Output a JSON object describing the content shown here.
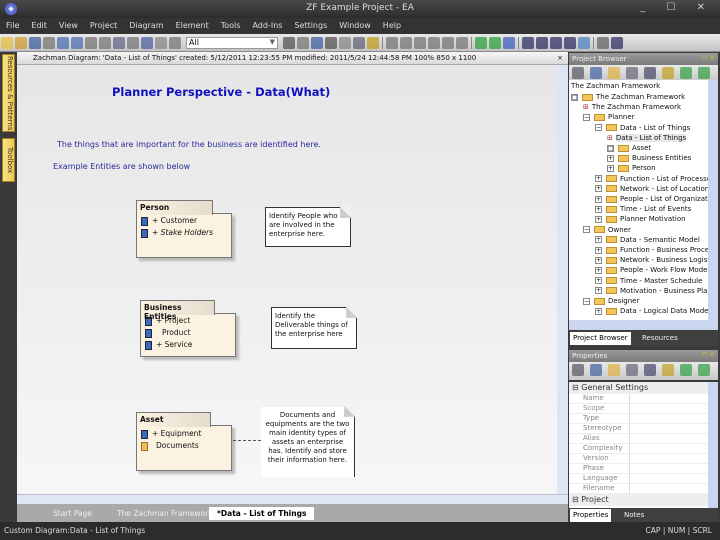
{
  "window": {
    "title": "ZF Example Project - EA",
    "logo": "ea-logo-icon",
    "controls": "_ ☐ ✕"
  },
  "menu": [
    "File",
    "Edit",
    "View",
    "Project",
    "Diagram",
    "Element",
    "Tools",
    "Add-Ins",
    "Settings",
    "Window",
    "Help"
  ],
  "toolbar": {
    "combo_value": "All"
  },
  "left_tabs": [
    "Resources & Patterns",
    "Toolbox"
  ],
  "diagram": {
    "header": "Zachman Diagram: 'Data - List of Things' created: 5/12/2011 12:23:55 PM modified: 2011/5/24 12:44:58 PM 100% 850 x 1100",
    "title": "Planner Perspective - Data(What)",
    "intro": "The things that are important for the business are identified here.",
    "example": "Example Entities are shown below",
    "classes": [
      {
        "name": "Person",
        "attrs": [
          "+ Customer",
          "+ Stake Holders"
        ]
      },
      {
        "name": "Business Entities",
        "attrs": [
          "+ Project",
          "Product",
          "+ Service"
        ]
      },
      {
        "name": "Asset",
        "attrs": [
          "+ Equipment",
          "Documents"
        ]
      }
    ],
    "notes": [
      "Identify People who are involved in the enterprise here.",
      "Identify the Deliverable things of the enterprise here",
      "Documents and equipments are the two main identity types of assets an enterprise has. Identify and store their information here."
    ],
    "tabs": [
      "Start Page",
      "The Zachman Framework",
      "*Data - List of Things"
    ],
    "active_tab": 2
  },
  "project_browser": {
    "title": "Project Browser",
    "root": "The Zachman Framework",
    "nodes": [
      {
        "label": "The Zachman Framework",
        "depth": 0,
        "exp": "□",
        "icon": "package"
      },
      {
        "label": "The Zachman Framework",
        "depth": 1,
        "exp": "",
        "icon": "diagram"
      },
      {
        "label": "Planner",
        "depth": 1,
        "exp": "−",
        "icon": "folder"
      },
      {
        "label": "Data - List of Things",
        "depth": 2,
        "exp": "−",
        "icon": "folder"
      },
      {
        "label": "Data - List of Things",
        "depth": 3,
        "exp": "",
        "icon": "diagram",
        "selected": true
      },
      {
        "label": "Asset",
        "depth": 3,
        "exp": "□",
        "icon": "folder"
      },
      {
        "label": "Business Entities",
        "depth": 3,
        "exp": "+",
        "icon": "folder"
      },
      {
        "label": "Person",
        "depth": 3,
        "exp": "+",
        "icon": "folder"
      },
      {
        "label": "Function - List of Processes",
        "depth": 2,
        "exp": "+",
        "icon": "folder"
      },
      {
        "label": "Network - List of Locations",
        "depth": 2,
        "exp": "+",
        "icon": "folder"
      },
      {
        "label": "People - List of Organizations",
        "depth": 2,
        "exp": "+",
        "icon": "folder"
      },
      {
        "label": "Time - List of Events",
        "depth": 2,
        "exp": "+",
        "icon": "folder"
      },
      {
        "label": "Planner Motivation",
        "depth": 2,
        "exp": "+",
        "icon": "folder"
      },
      {
        "label": "Owner",
        "depth": 1,
        "exp": "−",
        "icon": "folder"
      },
      {
        "label": "Data - Semantic Model",
        "depth": 2,
        "exp": "+",
        "icon": "folder"
      },
      {
        "label": "Function - Business Process Model",
        "depth": 2,
        "exp": "+",
        "icon": "folder"
      },
      {
        "label": "Network - Business Logistics System",
        "depth": 2,
        "exp": "+",
        "icon": "folder"
      },
      {
        "label": "People - Work Flow Model",
        "depth": 2,
        "exp": "+",
        "icon": "folder"
      },
      {
        "label": "Time - Master Schedule",
        "depth": 2,
        "exp": "+",
        "icon": "folder"
      },
      {
        "label": "Motivation - Business Plan",
        "depth": 2,
        "exp": "+",
        "icon": "folder"
      },
      {
        "label": "Designer",
        "depth": 1,
        "exp": "−",
        "icon": "folder"
      },
      {
        "label": "Data - Logical Data Model",
        "depth": 2,
        "exp": "+",
        "icon": "folder"
      }
    ],
    "tabs": [
      "Project Browser",
      "Resources"
    ]
  },
  "properties": {
    "title": "Properties",
    "group1": "General Settings",
    "rows": [
      "Name",
      "Scope",
      "Type",
      "Stereotype",
      "Alias",
      "Complexity",
      "Version",
      "Phase",
      "Language",
      "Filename"
    ],
    "group2": "Project",
    "tabs": [
      "Properties",
      "Notes"
    ]
  },
  "status": {
    "text": "Custom Diagram:Data - List of Things",
    "indicators": "CAP | NUM | SCRL"
  }
}
